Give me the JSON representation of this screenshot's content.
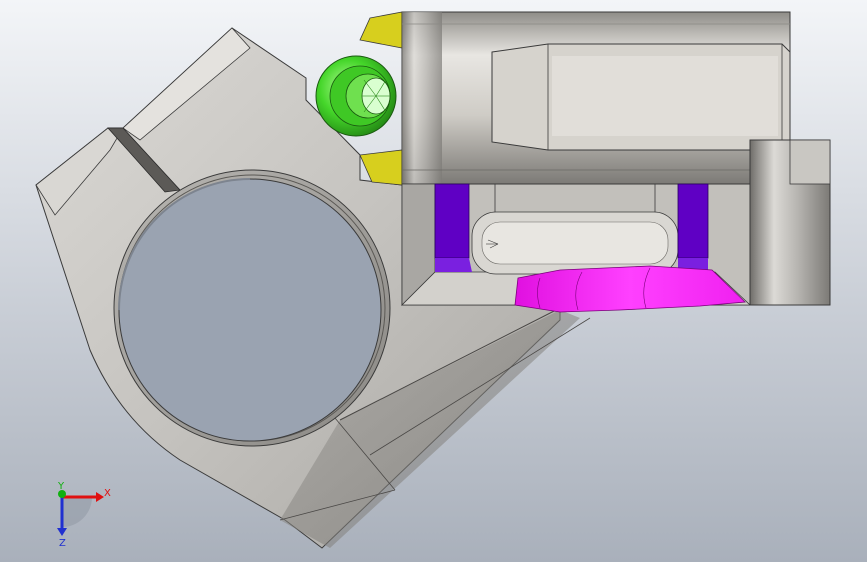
{
  "viewport": {
    "background_top": "#f3f5f8",
    "background_bottom": "#a9b0bb"
  },
  "model": {
    "body_color": "#c9c7c2",
    "body_shadow": "#8e8c88",
    "edge_color": "#3a3a3a",
    "bolt_color": "#45d62a",
    "washer_color": "#d7cf1e",
    "section_purple": "#5f00c4",
    "section_magenta": "#ff20ff"
  },
  "triad": {
    "x_label": "X",
    "y_label": "Y",
    "z_label": "Z",
    "x_color": "#e01010",
    "y_color": "#10b010",
    "z_color": "#2030d0",
    "icons": [
      "x-axis-arrow-icon",
      "y-axis-dot-icon",
      "z-axis-arrow-icon"
    ]
  }
}
